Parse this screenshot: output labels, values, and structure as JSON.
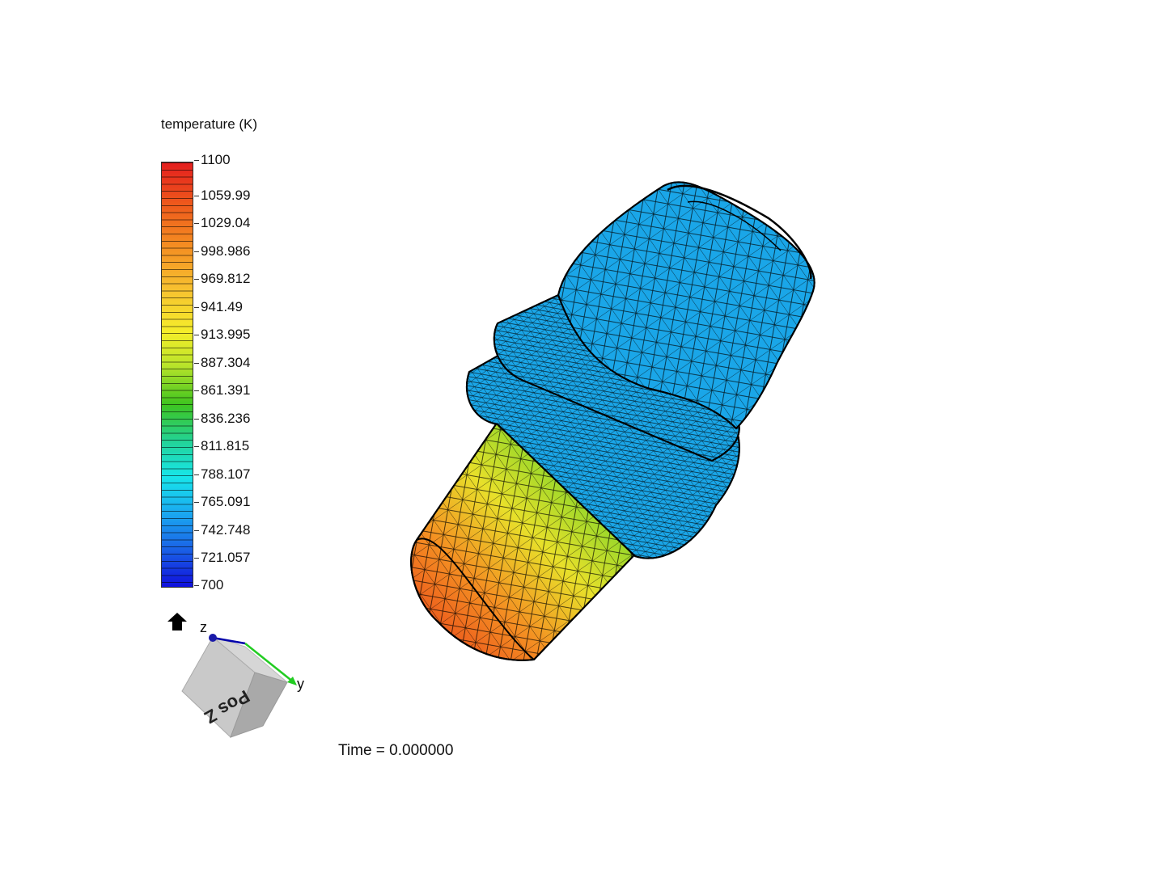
{
  "legend": {
    "title": "temperature (K)",
    "ticks": [
      "1100",
      "1059.99",
      "1029.04",
      "998.986",
      "969.812",
      "941.49",
      "913.995",
      "887.304",
      "861.391",
      "836.236",
      "811.815",
      "788.107",
      "765.091",
      "742.748",
      "721.057",
      "700"
    ],
    "range": [
      700,
      1100
    ]
  },
  "orientation": {
    "z_label": "z",
    "y_label": "y",
    "cube_face_label": "Pos Z"
  },
  "status": {
    "time_text": "Time = 0.000000"
  },
  "colors": {
    "hot": "#e41e1e",
    "cold": "#1010dd",
    "model_surface": "#1aa6e8",
    "mesh_lines": "#000000"
  },
  "icons": {
    "home": "home-icon",
    "orientation": "orientation-cube-icon"
  }
}
